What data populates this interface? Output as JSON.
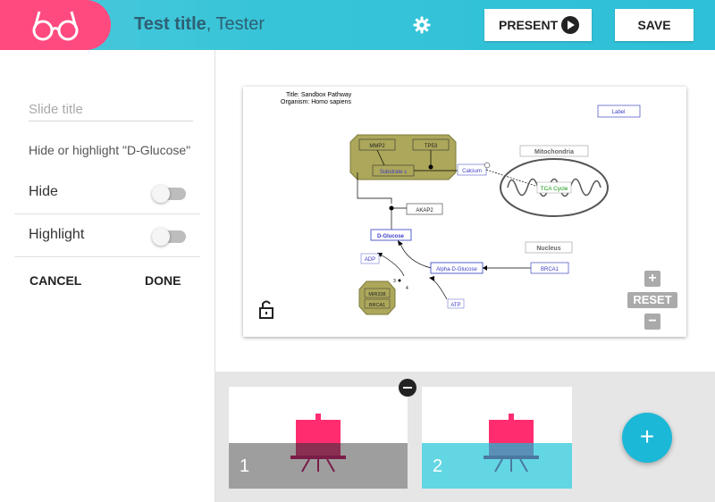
{
  "header": {
    "title_bold": "Test title",
    "title_rest": ", Tester",
    "present_label": "PRESENT",
    "save_label": "SAVE"
  },
  "sidebar": {
    "slide_title_placeholder": "Slide title",
    "hint": "Hide or highlight \"D-Glucose\"",
    "hide_label": "Hide",
    "hide_on": false,
    "highlight_label": "Highlight",
    "highlight_on": false,
    "cancel_label": "CANCEL",
    "done_label": "DONE"
  },
  "diagram": {
    "title_line": "Title: Sandbox Pathway",
    "organism_line": "Organism: Homo sapiens",
    "label_box": "Label",
    "mmp2": "MMP2",
    "tp53": "TP53",
    "substrate": "Substrate s",
    "calcium": "Calcium",
    "mitochondria": "Mitochondria",
    "tca": "TCA Cycle",
    "akap2": "AKAP2",
    "dglucose": "D-Glucose",
    "nucleus": "Nucleus",
    "adp": "ADP",
    "alpha": "Alpha-D-Glucose",
    "brca1_right": "BRCA1",
    "mir338": "MIR338",
    "brca1_node": "BRCA1",
    "atp": "ATP",
    "reset_label": "RESET"
  },
  "slides": [
    {
      "number": "1",
      "color": "#9e9e9e"
    },
    {
      "number": "2",
      "color": "#63d6e3"
    }
  ],
  "colors": {
    "accent": "#fe4a7f",
    "header": "#36c4d8",
    "fab": "#1cb8d8"
  }
}
